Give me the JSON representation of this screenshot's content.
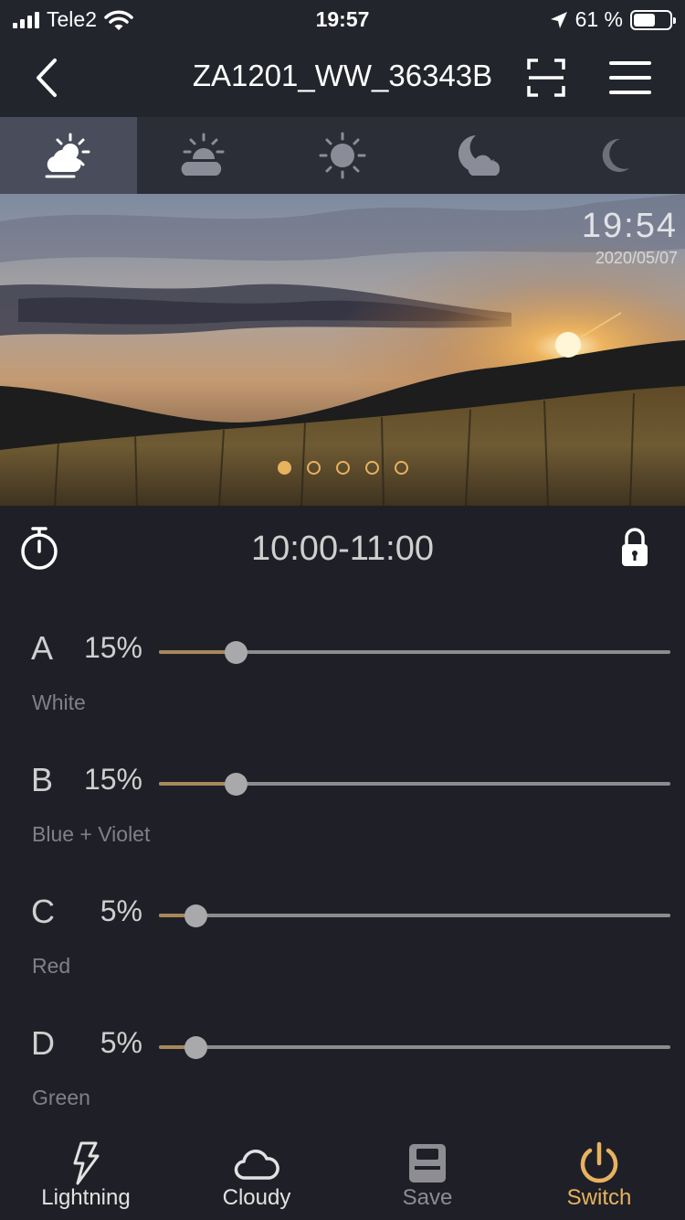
{
  "status_bar": {
    "carrier": "Tele2",
    "time": "19:57",
    "battery_percent": "61 %",
    "battery_level": 0.61,
    "icons": [
      "signal-bars-icon",
      "wifi-icon",
      "location-arrow-icon",
      "battery-icon"
    ]
  },
  "nav": {
    "title": "ZA1201_WW_36343B",
    "icons": [
      "back-arrow-icon",
      "scan-icon",
      "menu-icon"
    ]
  },
  "scene_tabs": [
    {
      "icon": "cloudy-sun-icon",
      "active": true
    },
    {
      "icon": "sunrise-icon",
      "active": false
    },
    {
      "icon": "sun-icon",
      "active": false
    },
    {
      "icon": "moon-cloud-icon",
      "active": false
    },
    {
      "icon": "moon-icon",
      "active": false
    }
  ],
  "banner": {
    "time": "19:54",
    "date": "2020/05/07",
    "page_count": 5,
    "active_page": 0
  },
  "period": {
    "range": "10:00-11:00",
    "icons": [
      "stopwatch-icon",
      "lock-icon"
    ]
  },
  "channels": [
    {
      "letter": "A",
      "percent_label": "15%",
      "value": 15,
      "name": "White"
    },
    {
      "letter": "B",
      "percent_label": "15%",
      "value": 15,
      "name": "Blue + Violet"
    },
    {
      "letter": "C",
      "percent_label": "5%",
      "value": 5,
      "name": "Red"
    },
    {
      "letter": "D",
      "percent_label": "5%",
      "value": 5,
      "name": "Green"
    }
  ],
  "bottom_bar": {
    "lightning": "Lightning",
    "cloudy": "Cloudy",
    "save": "Save",
    "switch": "Switch"
  },
  "colors": {
    "accent": "#e8b25f",
    "background": "#1f2027",
    "track_fill": "#a6885b"
  }
}
